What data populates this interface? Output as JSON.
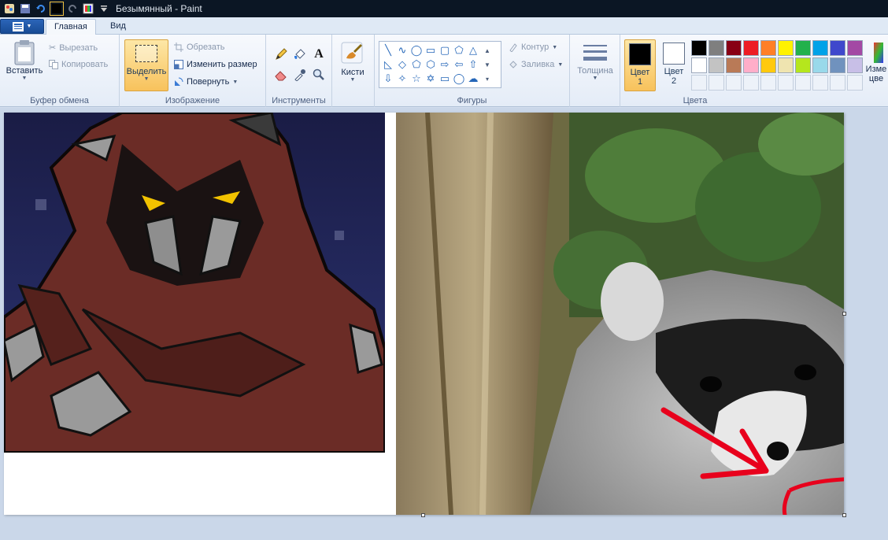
{
  "window": {
    "title": "Безымянный - Paint"
  },
  "tabs": [
    {
      "label": "Главная"
    },
    {
      "label": "Вид"
    }
  ],
  "clipboard": {
    "paste_label": "Вставить",
    "cut_label": "Вырезать",
    "copy_label": "Копировать",
    "group_label": "Буфер обмена"
  },
  "image": {
    "select_label": "Выделить",
    "crop_label": "Обрезать",
    "resize_label": "Изменить размер",
    "rotate_label": "Повернуть",
    "group_label": "Изображение"
  },
  "tools": {
    "group_label": "Инструменты",
    "items": [
      "pencil-icon",
      "fill-icon",
      "text-icon",
      "eraser-icon",
      "color-picker-icon",
      "magnifier-icon"
    ]
  },
  "brushes": {
    "label": "Кисти"
  },
  "shapes": {
    "outline_label": "Контур",
    "fill_label": "Заливка",
    "group_label": "Фигуры"
  },
  "size": {
    "label": "Толщина"
  },
  "colors": {
    "color1_label_line1": "Цвет",
    "color1_label_line2": "1",
    "color2_label_line1": "Цвет",
    "color2_label_line2": "2",
    "color1_value": "#000000",
    "color2_value": "#ffffff",
    "group_label": "Цвета",
    "edit_label": "Изме цве",
    "palette": [
      "#000000",
      "#7f7f7f",
      "#880015",
      "#ed1c24",
      "#ff7f27",
      "#fff200",
      "#22b14c",
      "#00a2e8",
      "#3f48cc",
      "#a349a4",
      "#ffffff",
      "#c3c3c3",
      "#b97a57",
      "#ffaec9",
      "#ffc90e",
      "#efe4b0",
      "#b5e61d",
      "#99d9ea",
      "#7092be",
      "#c8bfe7"
    ]
  }
}
